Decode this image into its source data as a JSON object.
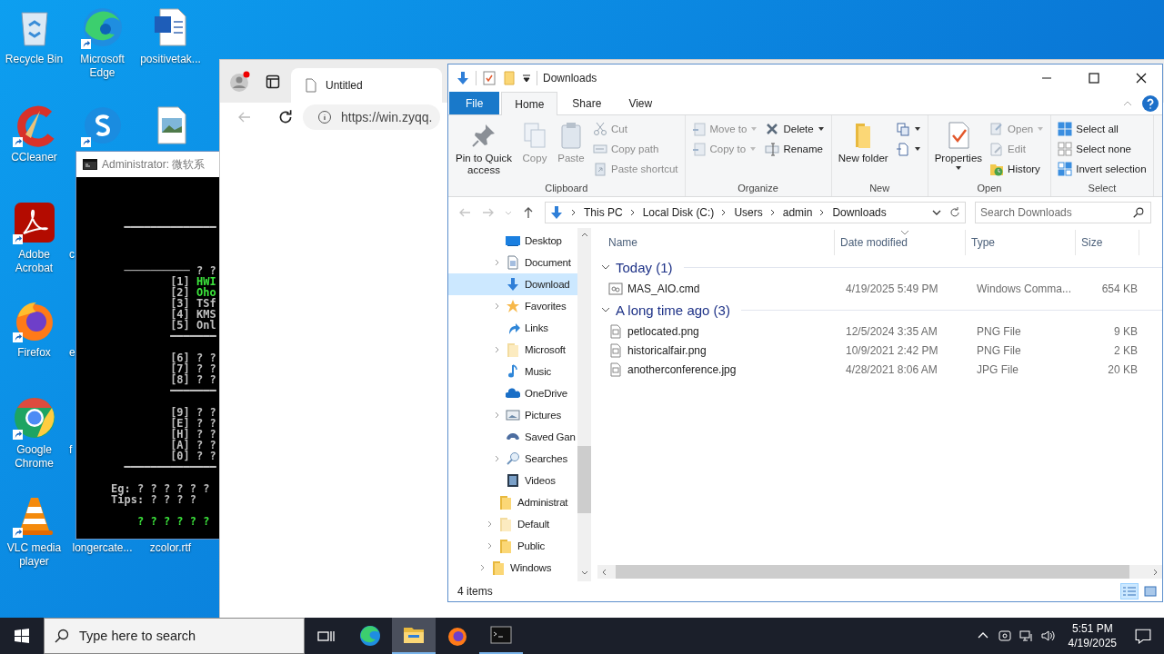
{
  "desktop_icons": [
    {
      "label": "Recycle Bin",
      "kind": "recycle-bin",
      "shortcut": false
    },
    {
      "label": "Microsoft Edge",
      "kind": "edge",
      "shortcut": true
    },
    {
      "label": "positivetak...",
      "kind": "word-document",
      "shortcut": false
    },
    {
      "label": "CCleaner",
      "kind": "ccleaner",
      "shortcut": true
    },
    {
      "kind": "s-app",
      "shortcut": true
    },
    {
      "kind": "image-file",
      "shortcut": false
    },
    {
      "label": "Adobe Acrobat",
      "kind": "acrobat",
      "shortcut": true
    },
    {
      "label": "c",
      "kind": "covered"
    },
    {
      "label": "Firefox",
      "kind": "firefox",
      "shortcut": true
    },
    {
      "label": "e",
      "kind": "covered"
    },
    {
      "label": "Google Chrome",
      "kind": "chrome",
      "shortcut": true
    },
    {
      "label": "f",
      "kind": "covered"
    },
    {
      "label": "VLC media player",
      "kind": "vlc",
      "shortcut": true
    },
    {
      "label": "longercate...",
      "kind": "covered"
    },
    {
      "label": "zcolor.rtf",
      "kind": "covered"
    }
  ],
  "cmd_window": {
    "title": "Administrator:  微软系",
    "lines": [
      {
        "kind": "blank"
      },
      {
        "kind": "blank"
      },
      {
        "kind": "blank"
      },
      {
        "kind": "blank"
      },
      {
        "kind": "text",
        "segments": [
          {
            "text": "       ━━━━━━━━━━━━━━",
            "color": "#c0c0c0"
          }
        ]
      },
      {
        "kind": "blank"
      },
      {
        "kind": "blank"
      },
      {
        "kind": "blank"
      },
      {
        "kind": "text",
        "segments": [
          {
            "text": "       ────────── ? ?",
            "color": "#c0c0c0"
          }
        ]
      },
      {
        "kind": "text",
        "segments": [
          {
            "text": "              [1] ",
            "color": "#c0c0c0"
          },
          {
            "text": "HWI",
            "color": "#3ce63c"
          }
        ]
      },
      {
        "kind": "text",
        "segments": [
          {
            "text": "              [2] ",
            "color": "#c0c0c0"
          },
          {
            "text": "Oho",
            "color": "#3ce63c"
          }
        ]
      },
      {
        "kind": "text",
        "segments": [
          {
            "text": "              [3] TSf",
            "color": "#c0c0c0"
          }
        ]
      },
      {
        "kind": "text",
        "segments": [
          {
            "text": "              [4] KMS",
            "color": "#c0c0c0"
          }
        ]
      },
      {
        "kind": "text",
        "segments": [
          {
            "text": "              [5] Onl",
            "color": "#c0c0c0"
          }
        ]
      },
      {
        "kind": "text",
        "segments": [
          {
            "text": "              ━━━━━━━",
            "color": "#c0c0c0"
          }
        ]
      },
      {
        "kind": "blank"
      },
      {
        "kind": "text",
        "segments": [
          {
            "text": "              [6] ? ?",
            "color": "#c0c0c0"
          }
        ]
      },
      {
        "kind": "text",
        "segments": [
          {
            "text": "              [7] ? ?",
            "color": "#c0c0c0"
          }
        ]
      },
      {
        "kind": "text",
        "segments": [
          {
            "text": "              [8] ? ?",
            "color": "#c0c0c0"
          }
        ]
      },
      {
        "kind": "text",
        "segments": [
          {
            "text": "              ━━━━━━━",
            "color": "#c0c0c0"
          }
        ]
      },
      {
        "kind": "blank"
      },
      {
        "kind": "text",
        "segments": [
          {
            "text": "              [9] ? ?",
            "color": "#c0c0c0"
          }
        ]
      },
      {
        "kind": "text",
        "segments": [
          {
            "text": "              [E] ? ?",
            "color": "#c0c0c0"
          }
        ]
      },
      {
        "kind": "text",
        "segments": [
          {
            "text": "              [H] ? ?",
            "color": "#c0c0c0"
          }
        ]
      },
      {
        "kind": "text",
        "segments": [
          {
            "text": "              [A] ? ?",
            "color": "#c0c0c0"
          }
        ]
      },
      {
        "kind": "text",
        "segments": [
          {
            "text": "              [0] ? ?",
            "color": "#c0c0c0"
          }
        ]
      },
      {
        "kind": "text",
        "segments": [
          {
            "text": "       ━━━━━━━━━━━━━━",
            "color": "#c0c0c0"
          }
        ]
      },
      {
        "kind": "blank"
      },
      {
        "kind": "text",
        "segments": [
          {
            "text": "     Eg: ? ? ? ? ? ?",
            "color": "#c0c0c0"
          }
        ]
      },
      {
        "kind": "text",
        "segments": [
          {
            "text": "     Tips: ? ? ? ?",
            "color": "#c0c0c0"
          }
        ]
      },
      {
        "kind": "blank"
      },
      {
        "kind": "text",
        "segments": [
          {
            "text": "         ? ? ? ? ? ?",
            "color": "#3ce63c"
          }
        ]
      }
    ]
  },
  "browser": {
    "tab": {
      "title": "Untitled",
      "selected": true
    },
    "address": "https://win.zyqq."
  },
  "explorer": {
    "title": "Downloads",
    "ribbon_tabs": [
      {
        "label": "File",
        "kind": "file",
        "selected": false
      },
      {
        "label": "Home",
        "kind": "tab",
        "selected": true
      },
      {
        "label": "Share",
        "kind": "tab",
        "selected": false
      },
      {
        "label": "View",
        "kind": "tab",
        "selected": false
      }
    ],
    "ribbon_groups": [
      {
        "label": "Clipboard",
        "columns": [
          [
            {
              "label": "Pin to Quick access",
              "kind": "large",
              "disabled": false,
              "dropdown": false
            }
          ],
          [
            {
              "label": "Copy",
              "kind": "large",
              "disabled": true,
              "dropdown": false
            }
          ],
          [
            {
              "label": "Paste",
              "kind": "large",
              "disabled": true,
              "dropdown": false
            }
          ],
          [
            {
              "label": "Cut",
              "kind": "small",
              "disabled": true,
              "dropdown": false
            },
            {
              "label": "Copy path",
              "kind": "small",
              "disabled": true,
              "dropdown": false
            },
            {
              "label": "Paste shortcut",
              "kind": "small",
              "disabled": true,
              "dropdown": false
            }
          ]
        ]
      },
      {
        "label": "Organize",
        "columns": [
          [
            {
              "label": "Move to",
              "kind": "small",
              "disabled": true,
              "dropdown": true
            },
            {
              "label": "Copy to",
              "kind": "small",
              "disabled": true,
              "dropdown": true
            }
          ],
          [
            {
              "label": "Delete",
              "kind": "small",
              "disabled": false,
              "dropdown": true
            },
            {
              "label": "Rename",
              "kind": "small",
              "disabled": false,
              "dropdown": false
            }
          ]
        ]
      },
      {
        "label": "New",
        "columns": [
          [
            {
              "label": "New folder",
              "kind": "large",
              "disabled": false,
              "dropdown": false
            }
          ],
          [
            {
              "kind": "small",
              "disabled": false,
              "dropdown": true
            },
            {
              "kind": "small",
              "disabled": false,
              "dropdown": true
            }
          ]
        ]
      },
      {
        "label": "Open",
        "columns": [
          [
            {
              "label": "Properties",
              "kind": "large",
              "disabled": false,
              "dropdown": true
            }
          ],
          [
            {
              "label": "Open",
              "kind": "small",
              "disabled": true,
              "dropdown": true
            },
            {
              "label": "Edit",
              "kind": "small",
              "disabled": true,
              "dropdown": false
            },
            {
              "label": "History",
              "kind": "small",
              "disabled": false,
              "dropdown": false
            }
          ]
        ]
      },
      {
        "label": "Select",
        "columns": [
          [
            {
              "label": "Select all",
              "kind": "small",
              "disabled": false,
              "dropdown": false
            },
            {
              "label": "Select none",
              "kind": "small",
              "disabled": false,
              "dropdown": false
            },
            {
              "label": "Invert selection",
              "kind": "small",
              "disabled": false,
              "dropdown": false
            }
          ]
        ]
      }
    ],
    "breadcrumbs": [
      "This PC",
      "Local Disk (C:)",
      "Users",
      "admin",
      "Downloads"
    ],
    "search": {
      "placeholder": "Search Downloads"
    },
    "nav_tree": [
      {
        "children": [
          {
            "children": [
              {
                "children": [
                  {
                    "label": "Desktop",
                    "kind": "desktop",
                    "expandable": false,
                    "selected": false
                  },
                  {
                    "label": "Document",
                    "kind": "documents",
                    "expandable": true,
                    "selected": false
                  },
                  {
                    "label": "Download",
                    "kind": "downloads",
                    "expandable": false,
                    "selected": true
                  },
                  {
                    "label": "Favorites",
                    "kind": "favorites",
                    "expandable": true,
                    "selected": false
                  },
                  {
                    "label": "Links",
                    "kind": "links",
                    "expandable": false,
                    "selected": false
                  },
                  {
                    "label": "Microsoft",
                    "kind": "folder-pale",
                    "expandable": true,
                    "selected": false
                  },
                  {
                    "label": "Music",
                    "kind": "music",
                    "expandable": false,
                    "selected": false
                  },
                  {
                    "label": "OneDrive",
                    "kind": "onedrive",
                    "expandable": false,
                    "selected": false
                  },
                  {
                    "label": "Pictures",
                    "kind": "pictures",
                    "expandable": true,
                    "selected": false
                  },
                  {
                    "label": "Saved Gan",
                    "kind": "games",
                    "expandable": false,
                    "selected": false
                  },
                  {
                    "label": "Searches",
                    "kind": "searches",
                    "expandable": true,
                    "selected": false
                  },
                  {
                    "label": "Videos",
                    "kind": "videos",
                    "expandable": false,
                    "selected": false
                  }
                ]
              },
              {
                "label": "Administrat",
                "kind": "folder",
                "expandable": false,
                "selected": false
              },
              {
                "label": "Default",
                "kind": "folder-pale",
                "expandable": true,
                "selected": false
              },
              {
                "label": "Public",
                "kind": "folder",
                "expandable": true,
                "selected": false
              }
            ]
          },
          {
            "label": "Windows",
            "kind": "folder",
            "expandable": true,
            "selected": false
          }
        ]
      }
    ],
    "columns": [
      {
        "label": "Name",
        "sorted": false
      },
      {
        "label": "Date modified",
        "sorted": true
      },
      {
        "label": "Type",
        "sorted": false
      },
      {
        "label": "Size",
        "sorted": false
      }
    ],
    "file_groups": [
      {
        "label": "Today (1)",
        "expanded": true,
        "files": [
          {
            "name": "MAS_AIO.cmd",
            "kind": "script",
            "date": "4/19/2025 5:49 PM",
            "type": "Windows Comma...",
            "size": "654 KB"
          }
        ]
      },
      {
        "label": "A long time ago (3)",
        "expanded": true,
        "files": [
          {
            "name": "petlocated.png",
            "kind": "image",
            "date": "12/5/2024 3:35 AM",
            "type": "PNG File",
            "size": "9 KB"
          },
          {
            "name": "historicalfair.png",
            "kind": "image",
            "date": "10/9/2021 2:42 PM",
            "type": "PNG File",
            "size": "2 KB"
          },
          {
            "name": "anotherconference.jpg",
            "kind": "image",
            "date": "4/28/2021 8:06 AM",
            "type": "JPG File",
            "size": "20 KB"
          }
        ]
      }
    ],
    "status": "4 items",
    "views": [
      {
        "kind": "details",
        "selected": true
      },
      {
        "kind": "large-icons",
        "selected": false
      }
    ]
  },
  "taskbar": {
    "search": {
      "placeholder": "Type here to search"
    },
    "apps": [
      {
        "kind": "edge",
        "active": false,
        "running": false
      },
      {
        "kind": "explorer",
        "active": true,
        "running": true
      },
      {
        "kind": "firefox",
        "active": false,
        "running": false
      },
      {
        "kind": "terminal",
        "active": false,
        "running": true
      }
    ],
    "time": "5:51 PM",
    "date": "4/19/2025"
  }
}
